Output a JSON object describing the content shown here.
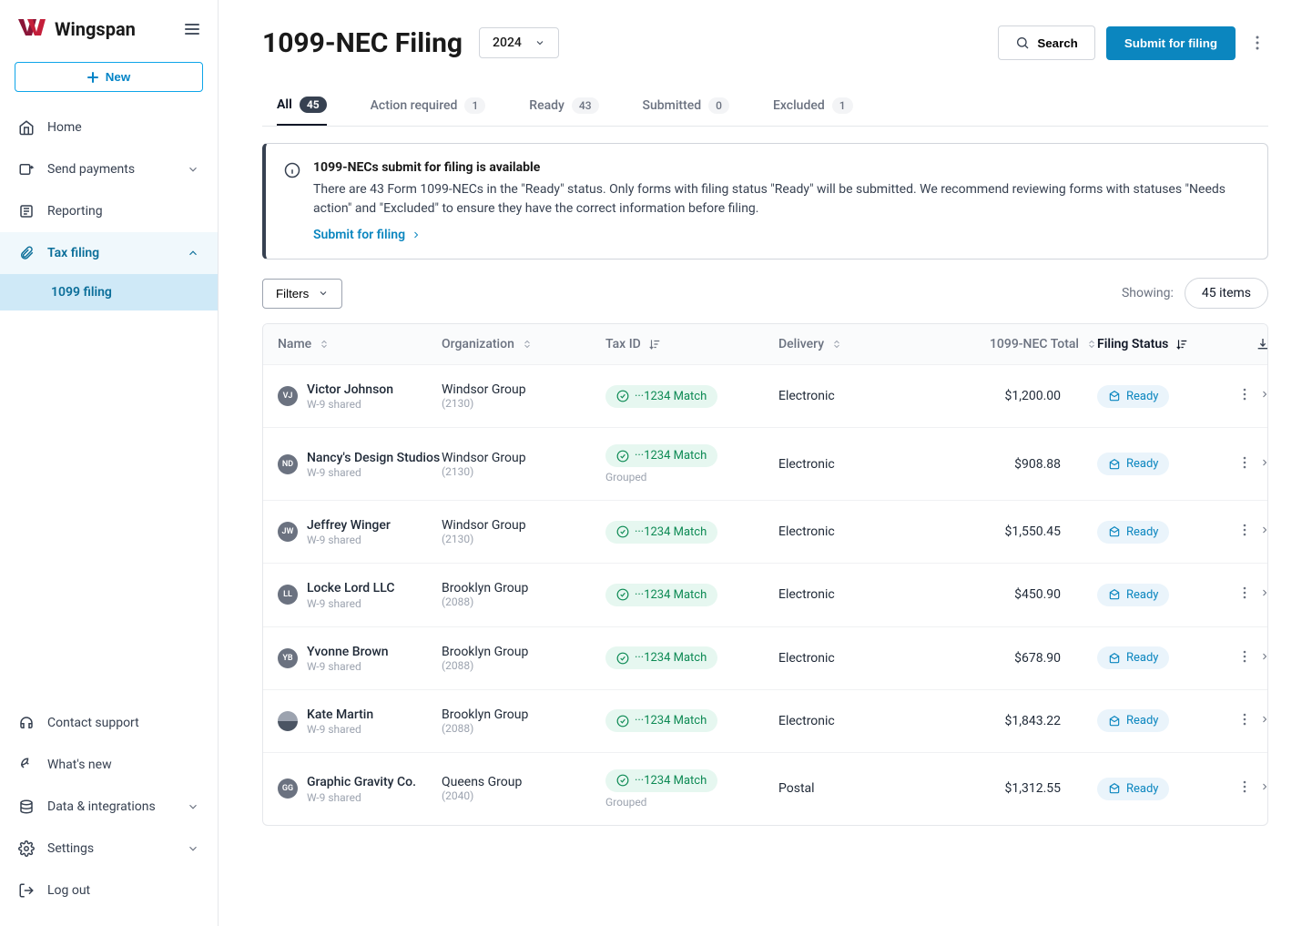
{
  "brand": {
    "name": "Wingspan",
    "new_button": "New"
  },
  "sidebar": {
    "home": "Home",
    "send_payments": "Send payments",
    "reporting": "Reporting",
    "tax_filing": "Tax filing",
    "tax_filing_sub": "1099 filing",
    "contact_support": "Contact support",
    "whats_new": "What's new",
    "data_integrations": "Data & integrations",
    "settings": "Settings",
    "log_out": "Log out"
  },
  "page": {
    "title": "1099-NEC Filing",
    "year": "2024",
    "search_label": "Search",
    "submit_label": "Submit for filing"
  },
  "tabs": [
    {
      "label": "All",
      "count": "45"
    },
    {
      "label": "Action required",
      "count": "1"
    },
    {
      "label": "Ready",
      "count": "43"
    },
    {
      "label": "Submitted",
      "count": "0"
    },
    {
      "label": "Excluded",
      "count": "1"
    }
  ],
  "banner": {
    "title": "1099-NECs submit for filing is available",
    "body": "There are 43 Form 1099-NECs in the \"Ready\" status. Only forms with filing status \"Ready\" will be submitted. We recommend reviewing forms with statuses \"Needs action\" and \"Excluded\" to ensure they have the correct information before filing.",
    "link": "Submit for filing"
  },
  "filters": {
    "label": "Filters",
    "showing_label": "Showing:",
    "showing_value": "45 items"
  },
  "columns": {
    "name": "Name",
    "organization": "Organization",
    "taxid": "Tax ID",
    "delivery": "Delivery",
    "total": "1099-NEC Total",
    "status": "Filing Status"
  },
  "rows": [
    {
      "initials": "VJ",
      "name": "Victor Johnson",
      "sub": "W-9 shared",
      "org": "Windsor Group",
      "orgcode": "(2130)",
      "taxid": "···1234 Match",
      "grouped": false,
      "delivery": "Electronic",
      "total": "$1,200.00",
      "status": "Ready"
    },
    {
      "initials": "ND",
      "name": "Nancy's Design Studios",
      "sub": "W-9 shared",
      "org": "Windsor Group",
      "orgcode": "(2130)",
      "taxid": "···1234 Match",
      "grouped": true,
      "delivery": "Electronic",
      "total": "$908.88",
      "status": "Ready"
    },
    {
      "initials": "JW",
      "name": "Jeffrey Winger",
      "sub": "W-9 shared",
      "org": "Windsor Group",
      "orgcode": "(2130)",
      "taxid": "···1234 Match",
      "grouped": false,
      "delivery": "Electronic",
      "total": "$1,550.45",
      "status": "Ready"
    },
    {
      "initials": "LL",
      "name": "Locke Lord LLC",
      "sub": "W-9 shared",
      "org": "Brooklyn Group",
      "orgcode": "(2088)",
      "taxid": "···1234 Match",
      "grouped": false,
      "delivery": "Electronic",
      "total": "$450.90",
      "status": "Ready"
    },
    {
      "initials": "YB",
      "name": "Yvonne Brown",
      "sub": "W-9 shared",
      "org": "Brooklyn Group",
      "orgcode": "(2088)",
      "taxid": "···1234 Match",
      "grouped": false,
      "delivery": "Electronic",
      "total": "$678.90",
      "status": "Ready"
    },
    {
      "initials": "",
      "name": "Kate Martin",
      "sub": "W-9 shared",
      "org": "Brooklyn Group",
      "orgcode": "(2088)",
      "taxid": "···1234 Match",
      "grouped": false,
      "delivery": "Electronic",
      "total": "$1,843.22",
      "status": "Ready",
      "avatar_img": true
    },
    {
      "initials": "GG",
      "name": "Graphic Gravity Co.",
      "sub": "W-9 shared",
      "org": "Queens Group",
      "orgcode": "(2040)",
      "taxid": "···1234 Match",
      "grouped": true,
      "delivery": "Postal",
      "total": "$1,312.55",
      "status": "Ready"
    }
  ],
  "labels": {
    "grouped": "Grouped"
  }
}
